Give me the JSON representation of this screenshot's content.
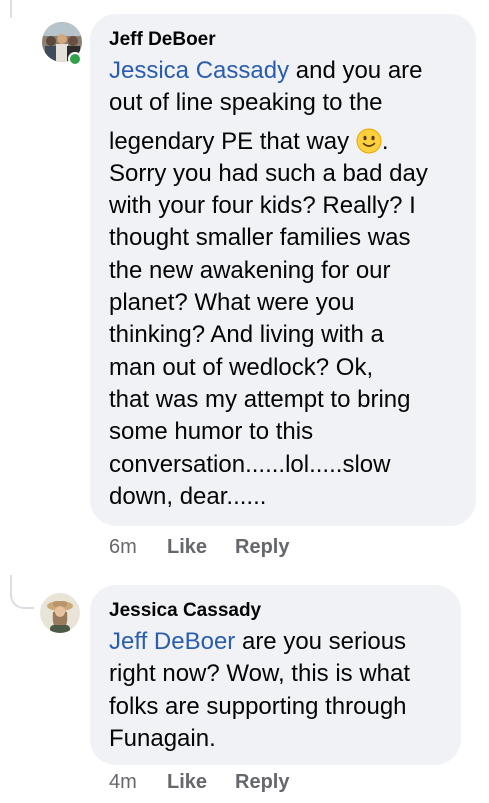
{
  "comments": [
    {
      "author": "Jeff DeBoer",
      "mention": "Jessica Cassady",
      "line1_rest": " and you are",
      "line2": "out of line speaking to the",
      "line3": "legendary PE that way",
      "line3_tail": ".",
      "emoji": "slightly-smiling-face-icon",
      "lines": [
        "Sorry you had such a bad day",
        "with your four kids?  Really?  I",
        "thought smaller families was",
        "the new awakening for our",
        "planet?  What were you",
        "thinking?  And living with a",
        "man out of wedlock?   Ok,",
        "that was my attempt to bring",
        "some humor to this",
        "conversation......lol.....slow",
        "down, dear......"
      ],
      "time": "6m",
      "like_label": "Like",
      "reply_label": "Reply",
      "online": true
    },
    {
      "author": "Jessica Cassady",
      "mention": "Jeff DeBoer",
      "line1_rest": " are you serious",
      "lines": [
        "right now? Wow, this is what",
        "folks are supporting through",
        "Funagain."
      ],
      "time": "4m",
      "like_label": "Like",
      "reply_label": "Reply"
    }
  ],
  "colors": {
    "bubble": "#f0f2f5",
    "mention": "#2a5db0",
    "meta": "#65676b",
    "online": "#31a24c"
  }
}
